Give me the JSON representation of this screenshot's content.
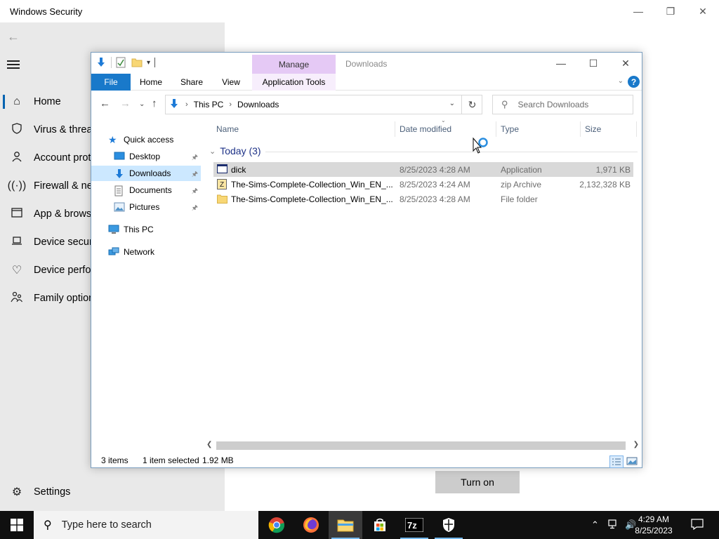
{
  "windows_security": {
    "title": "Windows Security",
    "nav": [
      {
        "label": "Home",
        "icon": "home-icon"
      },
      {
        "label": "Virus & threa",
        "icon": "shield-icon"
      },
      {
        "label": "Account prot",
        "icon": "person-icon"
      },
      {
        "label": "Firewall & ne",
        "icon": "antenna-icon"
      },
      {
        "label": "App & brows",
        "icon": "browser-window-icon"
      },
      {
        "label": "Device securi",
        "icon": "laptop-icon"
      },
      {
        "label": "Device perfor",
        "icon": "heart-icon"
      },
      {
        "label": "Family option",
        "icon": "family-icon"
      }
    ],
    "settings_label": "Settings",
    "turn_on_label": "Turn on"
  },
  "explorer": {
    "title": "Downloads",
    "manage_tab": "Manage",
    "ribbon_tabs": [
      "File",
      "Home",
      "Share",
      "View",
      "Application Tools"
    ],
    "breadcrumb": [
      "This PC",
      "Downloads"
    ],
    "search_placeholder": "Search Downloads",
    "nav_pane": {
      "quick_access": "Quick access",
      "items": [
        "Desktop",
        "Downloads",
        "Documents",
        "Pictures"
      ],
      "this_pc": "This PC",
      "network": "Network"
    },
    "columns": [
      "Name",
      "Date modified",
      "Type",
      "Size"
    ],
    "group_header": "Today (3)",
    "files": [
      {
        "name": "dick",
        "date": "8/25/2023 4:28 AM",
        "type": "Application",
        "size": "1,971 KB",
        "icon": "application-icon",
        "selected": true
      },
      {
        "name": "The-Sims-Complete-Collection_Win_EN_...",
        "date": "8/25/2023 4:24 AM",
        "type": "zip Archive",
        "size": "2,132,328 KB",
        "icon": "zip-archive-icon",
        "selected": false
      },
      {
        "name": "The-Sims-Complete-Collection_Win_EN_...",
        "date": "8/25/2023 4:28 AM",
        "type": "File folder",
        "size": "",
        "icon": "folder-icon",
        "selected": false
      }
    ],
    "status": {
      "items": "3 items",
      "selected": "1 item selected",
      "size": "1.92 MB"
    }
  },
  "taskbar": {
    "search_placeholder": "Type here to search",
    "apps": [
      "chrome-icon",
      "firefox-icon",
      "file-explorer-icon",
      "microsoft-store-icon",
      "7zip-icon",
      "windows-security-icon"
    ],
    "time": "4:29 AM",
    "date": "8/25/2023"
  },
  "colors": {
    "accent": "#1979ca",
    "manage_tab": "#e5c9f5",
    "selection": "#cce8ff",
    "taskbar": "#101010"
  }
}
